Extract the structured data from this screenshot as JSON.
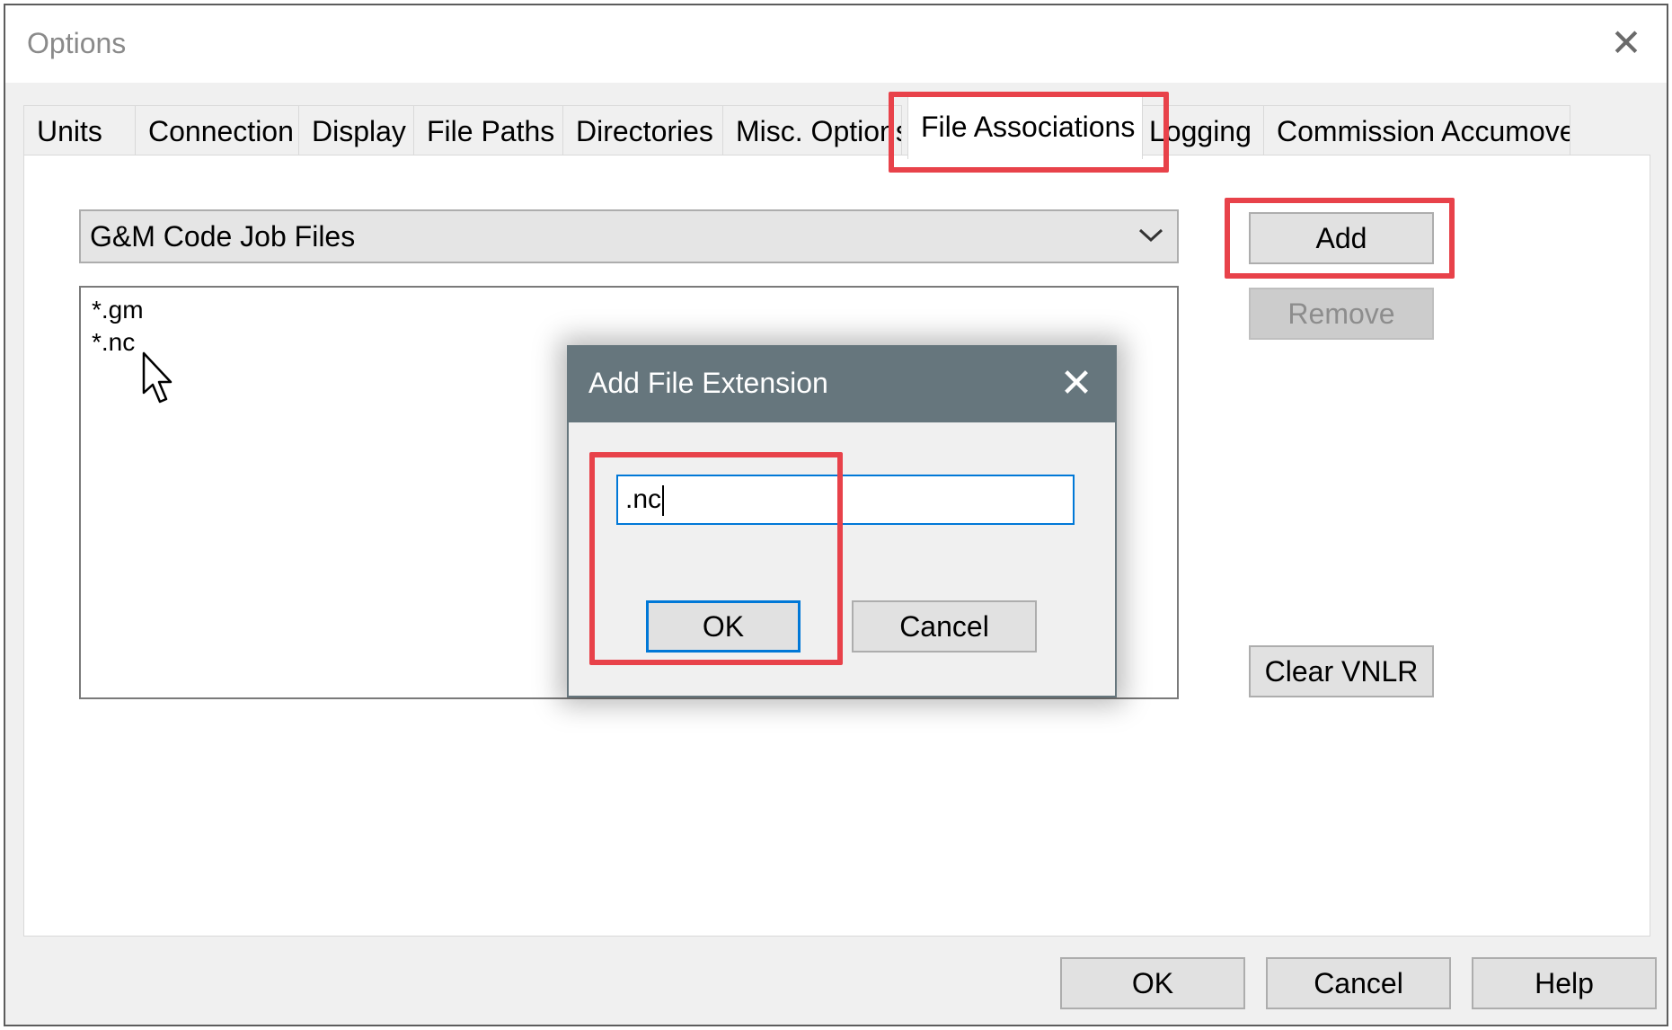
{
  "window": {
    "title": "Options",
    "close_glyph": "✕"
  },
  "tabs": [
    {
      "label": "Units"
    },
    {
      "label": "Connection"
    },
    {
      "label": "Display"
    },
    {
      "label": "File Paths"
    },
    {
      "label": "Directories"
    },
    {
      "label": "Misc. Options"
    },
    {
      "label": "File Associations",
      "active": true
    },
    {
      "label": "Logging"
    },
    {
      "label": "Commission Accumove"
    }
  ],
  "file_assoc": {
    "type_selected": "G&M Code Job Files",
    "dropdown_icon": "chevron-down-icon",
    "extensions": [
      "*.gm",
      "*.nc"
    ],
    "add_label": "Add",
    "remove_label": "Remove",
    "clear_vnlr_label": "Clear VNLR"
  },
  "add_dialog": {
    "title": "Add File Extension",
    "close_glyph": "✕",
    "input_value": ".nc",
    "ok_label": "OK",
    "cancel_label": "Cancel"
  },
  "footer": {
    "ok_label": "OK",
    "cancel_label": "Cancel",
    "help_label": "Help"
  },
  "colors": {
    "highlight": "#e8424a",
    "dialog_titlebar": "#66767d",
    "focus_blue": "#0078d7"
  }
}
